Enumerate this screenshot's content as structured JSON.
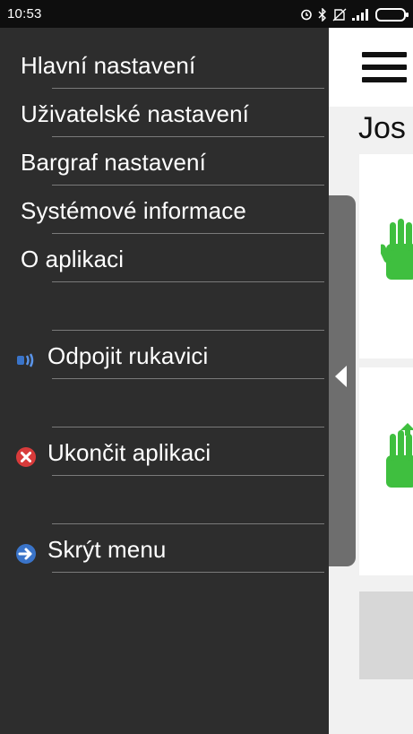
{
  "status": {
    "time": "10:53",
    "icons": [
      "alarm-icon",
      "bluetooth-icon",
      "no-sim-icon",
      "signal-icon",
      "battery-icon"
    ]
  },
  "app": {
    "title_partial": "Jos"
  },
  "drawer": {
    "items": [
      {
        "label": "Hlavní nastavení"
      },
      {
        "label": "Uživatelské nastavení"
      },
      {
        "label": "Bargraf nastavení"
      },
      {
        "label": "Systémové informace"
      },
      {
        "label": "O aplikaci"
      },
      {
        "label": "Odpojit rukavici",
        "icon": "disconnect-glove-icon"
      },
      {
        "label": "Ukončit aplikaci",
        "icon": "exit-icon"
      },
      {
        "label": "Skrýt menu",
        "icon": "hide-menu-icon"
      }
    ]
  },
  "colors": {
    "drawer_bg": "#2d2d2d",
    "accent_green": "#3fbf3f",
    "exit_red": "#d83b3b",
    "connect_blue": "#3a74c9"
  }
}
